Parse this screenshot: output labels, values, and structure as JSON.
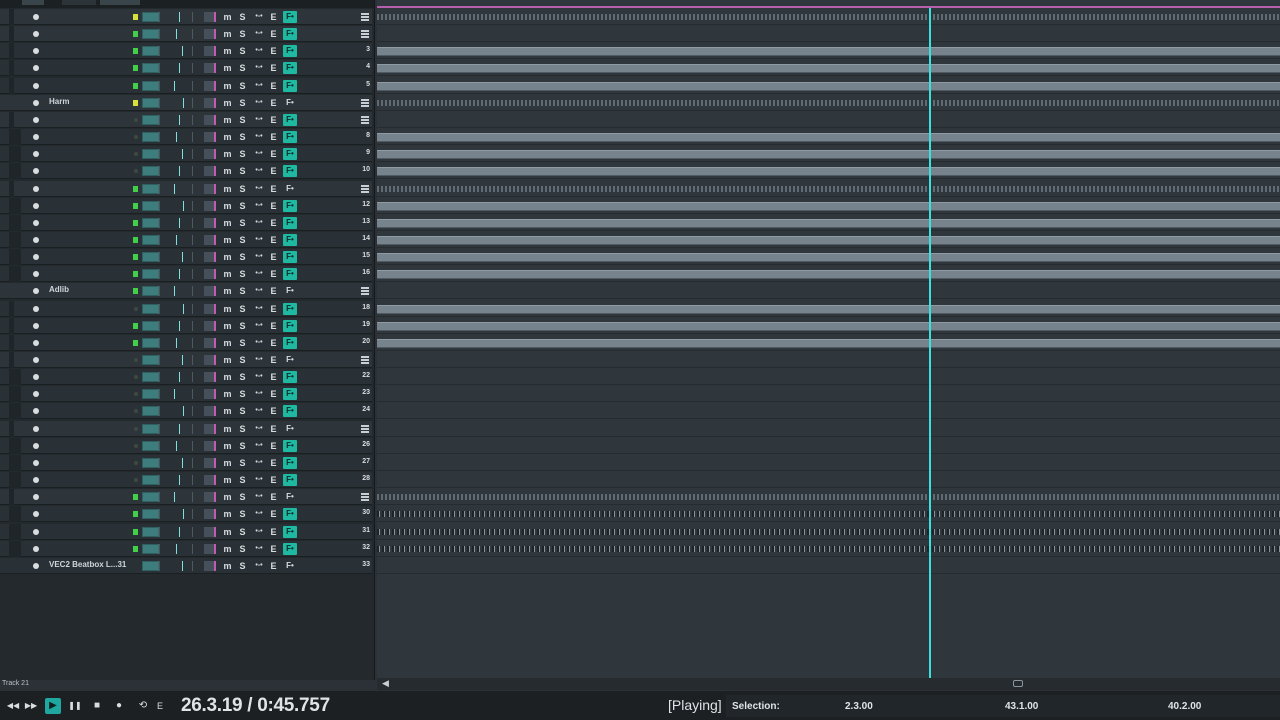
{
  "tracks": [
    {
      "num": "",
      "name": "",
      "meter": "yellow",
      "folder": true,
      "fx": "on",
      "level": 1
    },
    {
      "num": "",
      "name": "",
      "meter": "green",
      "folder": true,
      "fx": "on",
      "level": 1
    },
    {
      "num": "3",
      "name": "",
      "meter": "green",
      "folder": false,
      "fx": "on",
      "level": 1
    },
    {
      "num": "4",
      "name": "",
      "meter": "green",
      "folder": false,
      "fx": "on",
      "level": 1
    },
    {
      "num": "5",
      "name": "",
      "meter": "green",
      "folder": false,
      "fx": "on",
      "level": 1
    },
    {
      "num": "",
      "name": "Harm",
      "meter": "yellow",
      "folder": true,
      "fx": "off",
      "level": 0
    },
    {
      "num": "",
      "name": "",
      "meter": "dim",
      "folder": true,
      "fx": "on",
      "level": 1
    },
    {
      "num": "8",
      "name": "",
      "meter": "dim",
      "folder": false,
      "fx": "on",
      "level": 2
    },
    {
      "num": "9",
      "name": "",
      "meter": "dim",
      "folder": false,
      "fx": "on",
      "level": 2
    },
    {
      "num": "10",
      "name": "",
      "meter": "dim",
      "folder": false,
      "fx": "on",
      "level": 2
    },
    {
      "num": "",
      "name": "",
      "meter": "green",
      "folder": true,
      "fx": "off",
      "level": 1
    },
    {
      "num": "12",
      "name": "",
      "meter": "green",
      "folder": false,
      "fx": "on",
      "level": 2
    },
    {
      "num": "13",
      "name": "",
      "meter": "green",
      "folder": false,
      "fx": "on",
      "level": 2
    },
    {
      "num": "14",
      "name": "",
      "meter": "green",
      "folder": false,
      "fx": "on",
      "level": 2
    },
    {
      "num": "15",
      "name": "",
      "meter": "green",
      "folder": false,
      "fx": "on",
      "level": 2
    },
    {
      "num": "16",
      "name": "",
      "meter": "green",
      "folder": false,
      "fx": "on",
      "level": 2
    },
    {
      "num": "",
      "name": "Adlib",
      "meter": "green",
      "folder": true,
      "fx": "off",
      "level": 0
    },
    {
      "num": "18",
      "name": "",
      "meter": "dim",
      "folder": false,
      "fx": "on",
      "level": 1
    },
    {
      "num": "19",
      "name": "",
      "meter": "green",
      "folder": false,
      "fx": "on",
      "level": 1
    },
    {
      "num": "20",
      "name": "",
      "meter": "green",
      "folder": false,
      "fx": "on",
      "level": 1
    },
    {
      "num": "",
      "name": "",
      "meter": "dim",
      "folder": true,
      "fx": "off",
      "level": 1
    },
    {
      "num": "22",
      "name": "",
      "meter": "dim",
      "folder": false,
      "fx": "on",
      "level": 2
    },
    {
      "num": "23",
      "name": "",
      "meter": "dim",
      "folder": false,
      "fx": "on",
      "level": 2
    },
    {
      "num": "24",
      "name": "",
      "meter": "dim",
      "folder": false,
      "fx": "on",
      "level": 2
    },
    {
      "num": "",
      "name": "",
      "meter": "dim",
      "folder": true,
      "fx": "off",
      "level": 1
    },
    {
      "num": "26",
      "name": "",
      "meter": "dim",
      "folder": false,
      "fx": "on",
      "level": 2
    },
    {
      "num": "27",
      "name": "",
      "meter": "dim",
      "folder": false,
      "fx": "on",
      "level": 2
    },
    {
      "num": "28",
      "name": "",
      "meter": "dim",
      "folder": false,
      "fx": "on",
      "level": 2
    },
    {
      "num": "",
      "name": "",
      "meter": "green",
      "folder": true,
      "fx": "off",
      "level": 1
    },
    {
      "num": "30",
      "name": "",
      "meter": "green",
      "folder": false,
      "fx": "on",
      "level": 2
    },
    {
      "num": "31",
      "name": "",
      "meter": "green",
      "folder": false,
      "fx": "on",
      "level": 2
    },
    {
      "num": "32",
      "name": "",
      "meter": "green",
      "folder": false,
      "fx": "on",
      "level": 2
    },
    {
      "num": "33",
      "name": "VEC2 Beatbox L...31",
      "meter": "none",
      "folder": false,
      "fx": "off",
      "level": 0
    }
  ],
  "lanes": [
    {
      "kind": "wave"
    },
    {
      "kind": "none"
    },
    {
      "kind": "item"
    },
    {
      "kind": "item"
    },
    {
      "kind": "item"
    },
    {
      "kind": "wave"
    },
    {
      "kind": "none"
    },
    {
      "kind": "item"
    },
    {
      "kind": "item"
    },
    {
      "kind": "item"
    },
    {
      "kind": "wave"
    },
    {
      "kind": "item"
    },
    {
      "kind": "item"
    },
    {
      "kind": "item"
    },
    {
      "kind": "item"
    },
    {
      "kind": "item"
    },
    {
      "kind": "none"
    },
    {
      "kind": "item"
    },
    {
      "kind": "item"
    },
    {
      "kind": "item"
    },
    {
      "kind": "none"
    },
    {
      "kind": "none"
    },
    {
      "kind": "none"
    },
    {
      "kind": "none"
    },
    {
      "kind": "none"
    },
    {
      "kind": "none"
    },
    {
      "kind": "none"
    },
    {
      "kind": "none"
    },
    {
      "kind": "wave"
    },
    {
      "kind": "dark"
    },
    {
      "kind": "dark"
    },
    {
      "kind": "dark"
    },
    {
      "kind": "none"
    }
  ],
  "track_buttons": {
    "mute": "m",
    "solo": "S",
    "io": "•-•",
    "env": "E",
    "fx": "F•"
  },
  "status": {
    "track_label": "Track 21"
  },
  "transport": {
    "time": "26.3.19 / 0:45.757",
    "state": "[Playing]",
    "selection_label": "Selection:",
    "selection_start": "2.3.00",
    "selection_end": "43.1.00",
    "selection_length": "40.2.00",
    "buttons": {
      "rewind": "◀◀",
      "forward": "▶▶",
      "play": "▶",
      "pause": "❚❚",
      "stop": "■",
      "record": "●",
      "repeat": "⟲",
      "edit": "E"
    }
  },
  "scroll": {
    "left_arrow": "◀"
  },
  "colors": {
    "playhead": "#39e0dc",
    "fx_on": "#1fb9a2",
    "meter_green": "#42d04a",
    "meter_yellow": "#d8e03a",
    "play_button": "#1fa8a0"
  }
}
